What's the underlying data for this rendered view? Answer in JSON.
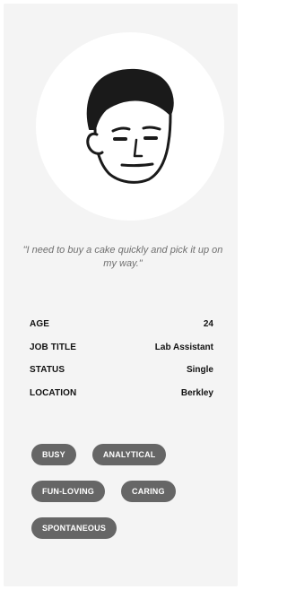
{
  "persona": {
    "avatar_icon": "user-avatar-line-drawing",
    "quote": "\"I need to buy a cake quickly and pick it up on my way.\"",
    "details": [
      {
        "label": "AGE",
        "value": "24"
      },
      {
        "label": "JOB TITLE",
        "value": "Lab Assistant"
      },
      {
        "label": "STATUS",
        "value": "Single"
      },
      {
        "label": "LOCATION",
        "value": "Berkley"
      }
    ],
    "traits": [
      "BUSY",
      "ANALYTICAL",
      "FUN-LOVING",
      "CARING",
      "SPONTANEOUS"
    ]
  },
  "colors": {
    "card_background": "#f4f4f4",
    "tag_background": "#666666",
    "quote_text": "#6f6f6f"
  }
}
